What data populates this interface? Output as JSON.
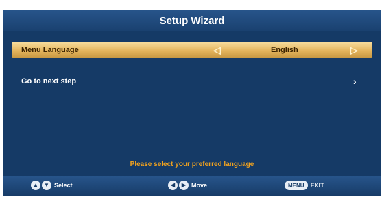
{
  "title": "Setup Wizard",
  "rows": [
    {
      "label": "Menu Language",
      "value": "English",
      "left_arrow": "◁",
      "right_arrow": "▷"
    },
    {
      "label": "Go to next step",
      "right_arrow": "›"
    }
  ],
  "hint": "Please select your preferred language",
  "footer": {
    "select": {
      "keys": [
        "▲",
        "▼"
      ],
      "label": "Select"
    },
    "move": {
      "keys": [
        "◀",
        "▶"
      ],
      "label": "Move"
    },
    "exit": {
      "key": "MENU",
      "label": "EXIT"
    }
  },
  "colors": {
    "background": "#153a66",
    "highlight": "#e4b45c",
    "hint": "#f0a21f"
  }
}
